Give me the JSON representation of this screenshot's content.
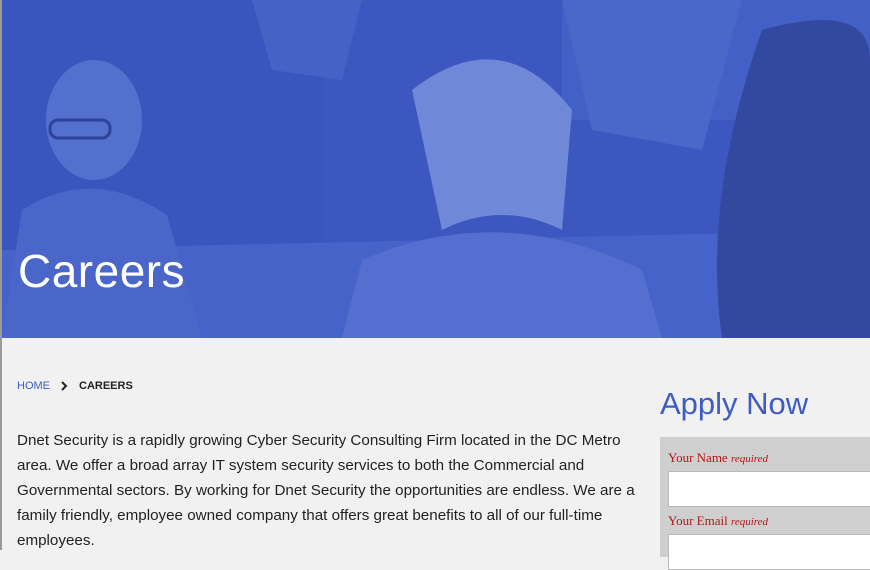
{
  "hero": {
    "title": "Careers",
    "image": "team-meeting-photo"
  },
  "breadcrumb": {
    "home": "HOME",
    "separator_icon": "chevron-right-icon",
    "current": "CAREERS"
  },
  "intro": {
    "text": "Dnet Security is a rapidly growing Cyber Security Consulting Firm located in the DC Metro area. We offer a broad array IT system security services to both the Commercial and Governmental sectors. By working for Dnet Security the opportunities are endless. We are a family friendly, employee owned company that offers great benefits to all of our full-time employees."
  },
  "apply": {
    "title": "Apply Now",
    "name_label": "Your Name",
    "name_required": "required",
    "email_label": "Your Email",
    "email_required": "required",
    "name_value": "",
    "email_value": ""
  },
  "colors": {
    "accent": "#3f5bc4",
    "required_label": "#b01818",
    "page_bg": "#f1f1f1"
  }
}
